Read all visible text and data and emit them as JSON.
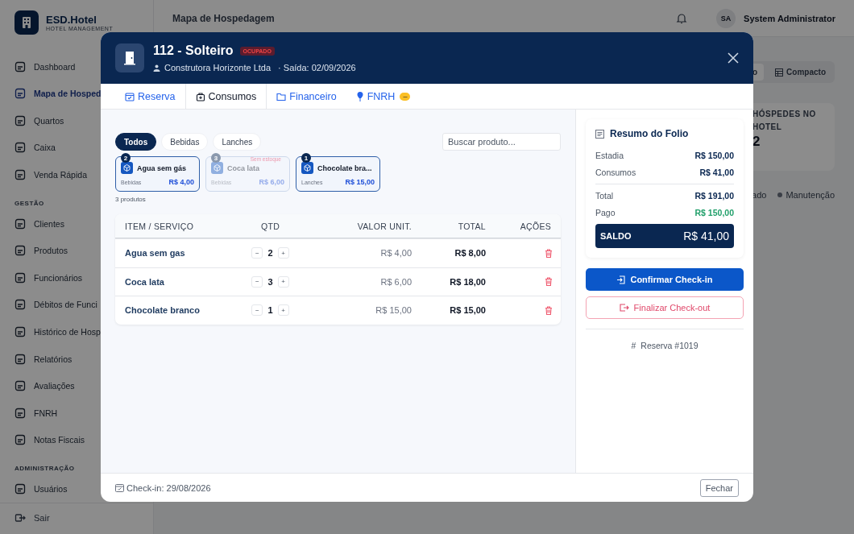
{
  "app": {
    "name": "ESD.Hotel",
    "subtitle": "HOTEL MANAGEMENT"
  },
  "sidebar": {
    "sections": [
      {
        "items": [
          {
            "label": "Dashboard",
            "selected": false
          },
          {
            "label": "Mapa de Hosped",
            "selected": true
          },
          {
            "label": "Quartos",
            "selected": false
          },
          {
            "label": "Caixa",
            "selected": false
          },
          {
            "label": "Venda Rápida",
            "selected": false
          }
        ]
      },
      {
        "title": "GESTÃO",
        "items": [
          {
            "label": "Clientes",
            "selected": false
          },
          {
            "label": "Produtos",
            "selected": false
          },
          {
            "label": "Funcionários",
            "selected": false
          },
          {
            "label": "Débitos de Funci",
            "selected": false
          },
          {
            "label": "Histórico de Hosp",
            "selected": false
          },
          {
            "label": "Relatórios",
            "selected": false
          },
          {
            "label": "Avaliações",
            "selected": false
          },
          {
            "label": "FNRH",
            "selected": false
          },
          {
            "label": "Notas Fiscais",
            "selected": false
          }
        ]
      },
      {
        "title": "ADMINISTRAÇÃO",
        "items": [
          {
            "label": "Usuários",
            "selected": false
          }
        ]
      }
    ],
    "logout": "Sair"
  },
  "header": {
    "title": "Mapa de Hospedagem",
    "user_initials": "SA",
    "user_name": "System Administrator"
  },
  "background": {
    "view_buttons": [
      "o",
      "Compacto"
    ],
    "stat": {
      "label": "HÓSPEDES NO HOTEL",
      "value": "2"
    },
    "legend": [
      {
        "label": "ado"
      },
      {
        "label": "Manutenção"
      }
    ]
  },
  "modal": {
    "title": "112 - Solteiro",
    "status": "OCUPADO",
    "guest": "Construtora Horizonte Ltda",
    "checkout": "· Saída: 02/09/2026",
    "tabs": [
      {
        "label": "Reserva",
        "selected": false
      },
      {
        "label": "Consumos",
        "selected": true
      },
      {
        "label": "Financeiro",
        "selected": false
      },
      {
        "label": "FNRH",
        "selected": false,
        "badge": "–"
      }
    ],
    "filters": [
      {
        "label": "Todos",
        "selected": true
      },
      {
        "label": "Bebidas",
        "selected": false
      },
      {
        "label": "Lanches",
        "selected": false
      }
    ],
    "search": {
      "placeholder": "Buscar produto..."
    },
    "products": [
      {
        "name": "Agua sem gás",
        "category": "Bebidas",
        "price": "R$ 4,00",
        "count": "2",
        "out_of_stock": false
      },
      {
        "name": "Coca lata",
        "category": "Bebidas",
        "price": "R$ 6,00",
        "count": "3",
        "out_of_stock": true,
        "stock_note": "Sem estoque"
      },
      {
        "name": "Chocolate bra...",
        "category": "Lanches",
        "price": "R$ 15,00",
        "count": "1",
        "out_of_stock": false
      }
    ],
    "product_count": "3 produtos",
    "table": {
      "columns": [
        "ITEM / SERVIÇO",
        "QTD",
        "VALOR UNIT.",
        "TOTAL",
        "AÇÕES"
      ],
      "rows": [
        {
          "item": "Agua sem gas",
          "qty": "2",
          "unit": "R$ 4,00",
          "total": "R$ 8,00"
        },
        {
          "item": "Coca lata",
          "qty": "3",
          "unit": "R$ 6,00",
          "total": "R$ 18,00"
        },
        {
          "item": "Chocolate branco",
          "qty": "1",
          "unit": "R$ 15,00",
          "total": "R$ 15,00"
        }
      ]
    },
    "stepper": {
      "minus": "−",
      "plus": "+"
    },
    "folio": {
      "title": "Resumo do Folio",
      "lines": [
        {
          "label": "Estadia",
          "value": "R$ 150,00",
          "kind": "plain"
        },
        {
          "label": "Consumos",
          "value": "R$ 41,00",
          "kind": "plain"
        },
        {
          "label": "Total",
          "value": "R$ 191,00",
          "kind": "total"
        },
        {
          "label": "Pago",
          "value": "R$ 150,00",
          "kind": "paid"
        }
      ],
      "balance_label": "SALDO",
      "balance": "R$ 41,00"
    },
    "confirm_button": "Confirmar Check-in",
    "checkout_button": "Finalizar Check-out",
    "reservation_hash": "#",
    "reservation": "Reserva #1019",
    "checkin": "Check-in: 29/08/2026",
    "close_button": "Fechar"
  }
}
